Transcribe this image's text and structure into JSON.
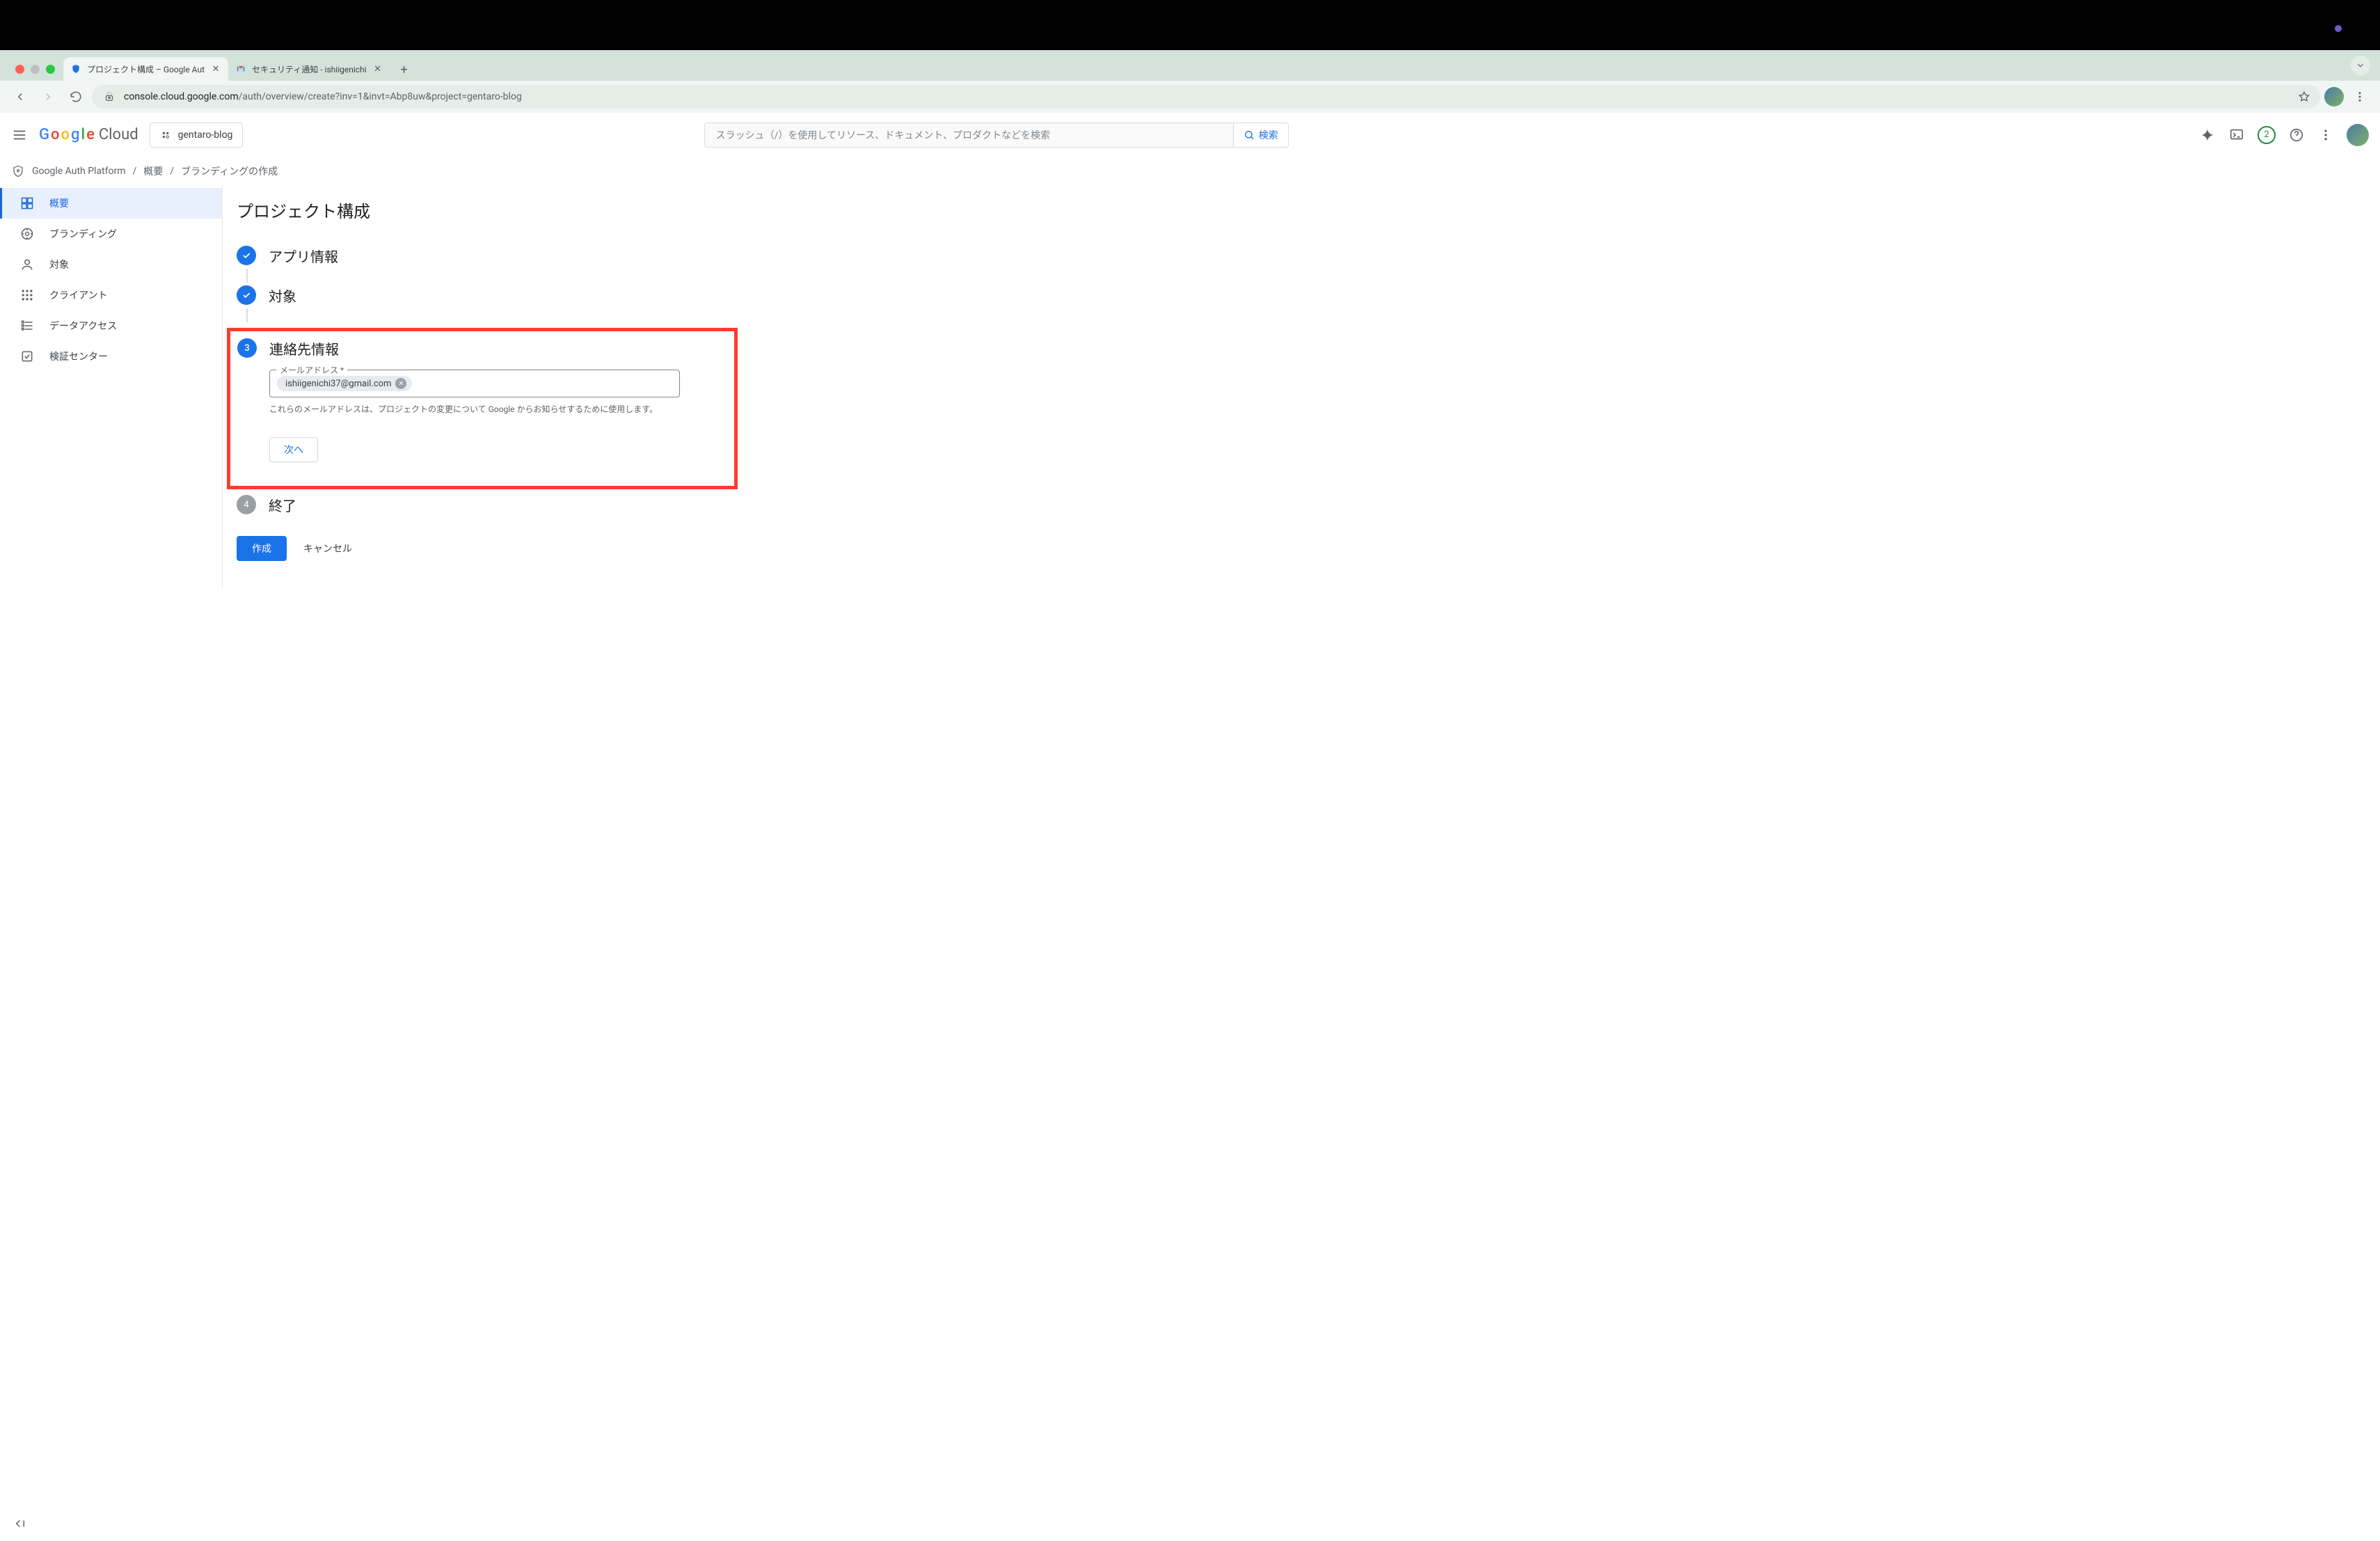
{
  "browser": {
    "tabs": [
      {
        "title": "プロジェクト構成 – Google Aut",
        "active": true,
        "favicon": "shield"
      },
      {
        "title": "セキュリティ通知 - ishiigenichi",
        "active": false,
        "favicon": "gmail"
      }
    ],
    "url_domain": "console.cloud.google.com",
    "url_path": "/auth/overview/create?inv=1&invt=Abp8uw&project=gentaro-blog"
  },
  "header": {
    "logo_text": "Cloud",
    "project": "gentaro-blog",
    "search_placeholder": "スラッシュ（/）を使用してリソース、ドキュメント、プロダクトなどを検索",
    "search_button": "検索",
    "notif_count": "2"
  },
  "breadcrumb": {
    "root": "Google Auth Platform",
    "level1": "概要",
    "level2": "ブランディングの作成"
  },
  "sidenav": {
    "items": [
      {
        "label": "概要",
        "icon": "dashboard"
      },
      {
        "label": "ブランディング",
        "icon": "branding"
      },
      {
        "label": "対象",
        "icon": "person"
      },
      {
        "label": "クライアント",
        "icon": "apps"
      },
      {
        "label": "データアクセス",
        "icon": "list"
      },
      {
        "label": "検証センター",
        "icon": "check-box"
      }
    ]
  },
  "content": {
    "page_title": "プロジェクト構成",
    "steps": [
      {
        "title": "アプリ情報"
      },
      {
        "title": "対象"
      },
      {
        "title": "連絡先情報"
      },
      {
        "title": "終了"
      }
    ],
    "step3": {
      "number": "3",
      "field_label": "メールアドレス *",
      "chip_value": "ishiigenichi37@gmail.com",
      "hint": "これらのメールアドレスは、プロジェクトの変更について Google からお知らせするために使用します。",
      "next_button": "次へ"
    },
    "step4_number": "4",
    "actions": {
      "create": "作成",
      "cancel": "キャンセル"
    }
  }
}
